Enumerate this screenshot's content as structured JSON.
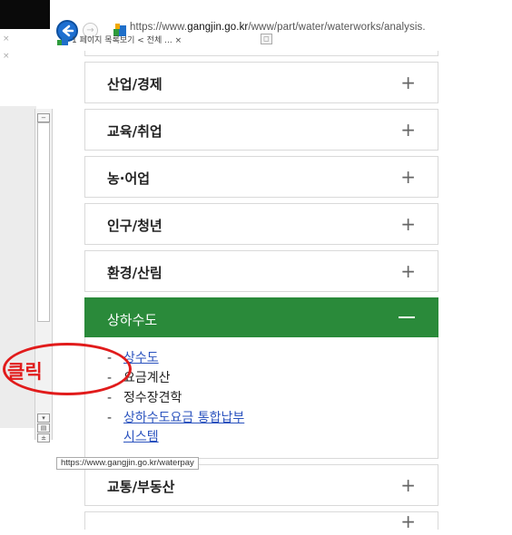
{
  "browser": {
    "url_prefix": "https://www.",
    "url_domain": "gangjin.go.kr",
    "url_rest": "/www/part/water/waterworks/analysis.",
    "tab_title": "1 페이지 목록보기 < 전체 ...",
    "tab_close": "×",
    "status_url": "https://www.gangjin.go.kr/waterpay"
  },
  "menu": {
    "items": [
      {
        "label": "산업/경제",
        "icon": "+"
      },
      {
        "label": "교육/취업",
        "icon": "+"
      },
      {
        "label": "농·어업",
        "icon": "+"
      },
      {
        "label": "인구/청년",
        "icon": "+"
      },
      {
        "label": "환경/산림",
        "icon": "+"
      }
    ],
    "active": {
      "label": "상하수도",
      "icon": "−"
    },
    "submenu": [
      {
        "label": "상수도",
        "link": true
      },
      {
        "label": "요금계산",
        "link": false
      },
      {
        "label": "정수장견학",
        "link": false
      },
      {
        "label": "상하수도요금 통합납부",
        "label2": "시스템",
        "link": true
      }
    ],
    "after": [
      {
        "label": "교통/부동산",
        "icon": "+"
      },
      {
        "label": "",
        "icon": "+"
      }
    ]
  },
  "annotation": {
    "text": "클릭",
    "color": "#e11b1b"
  },
  "colors": {
    "active_bg": "#2a8a3a",
    "link": "#2a52be",
    "back_button": "#1e6fd1"
  }
}
